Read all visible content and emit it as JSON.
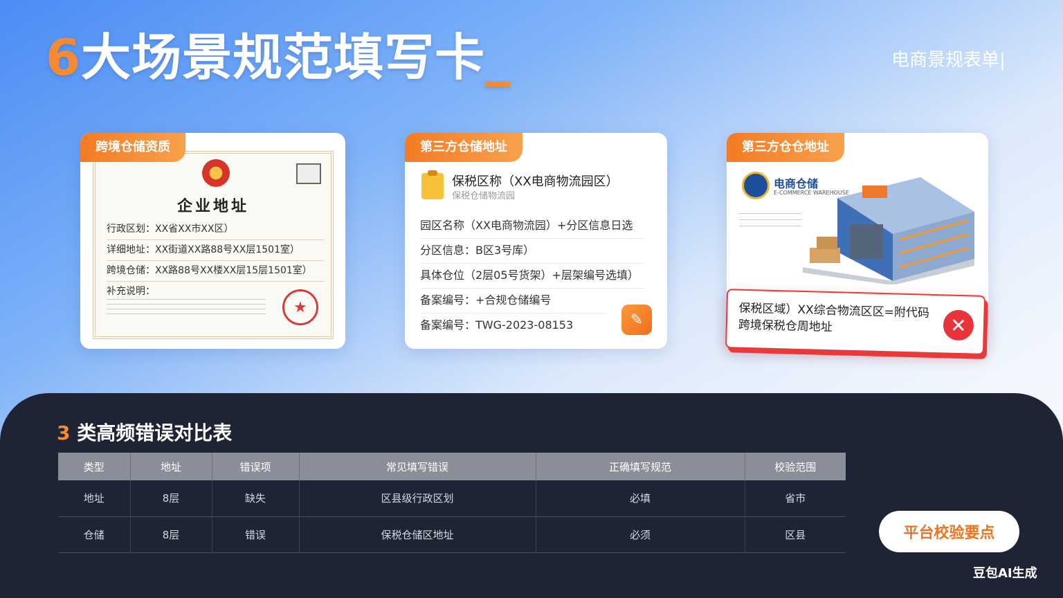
{
  "header": {
    "title_num": "6",
    "title_text": "大场景规范填写卡",
    "title_cursor": "_",
    "top_right_tag": "电商景规表单|"
  },
  "cards": [
    {
      "tag": "跨境仓储资质",
      "cert_title": "企业地址",
      "rows": [
        "行政区划：XX省XX市XX区）",
        "详细地址：XX街道XX路88号XX层1501室）",
        "跨境仓储：XX路88号XX楼XX层15层1501室）",
        "补充说明："
      ]
    },
    {
      "tag": "第三方仓储地址",
      "title": "保税区称（XX电商物流园区）",
      "subtitle": "保税仓储物流园",
      "rows": [
        "园区名称（XX电商物流园）+分区信息日选",
        "分区信息：B区3号库）",
        "具体仓位（2层05号货架）+层架编号选填）",
        "备案编号：+合规仓储编号",
        "备案编号：TWG-2023-08153"
      ]
    },
    {
      "tag": "第三方仓仓地址",
      "logo_text": "电商仓储",
      "logo_small": "E-COMMERCE WAREHOUSE"
    }
  ],
  "error_box": {
    "line1": "保税区域）XX综合物流区区=附代码",
    "line2": "跨境保税仓周地址"
  },
  "bottom": {
    "title_num": "3",
    "title_text": "类高频错误对比表",
    "table": {
      "headers": [
        "类型",
        "地址",
        "错误项",
        "常见填写错误",
        "正确填写规范",
        "校验范围"
      ],
      "rows": [
        [
          "地址",
          "8层",
          "缺失",
          "区县级行政区划",
          "必填",
          "省市"
        ],
        [
          "仓储",
          "8层",
          "错误",
          "保税仓储区地址",
          "必须",
          "区县"
        ]
      ]
    },
    "button_label": "平台校验要点",
    "watermark": "豆包AI生成"
  }
}
